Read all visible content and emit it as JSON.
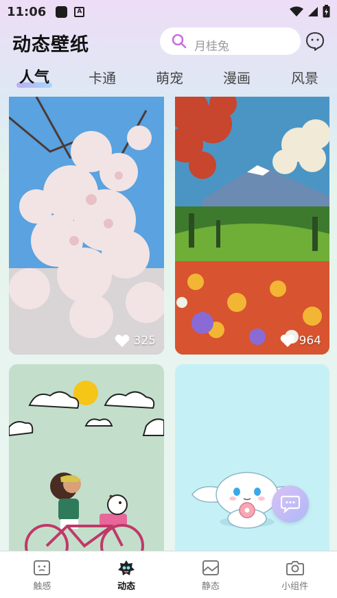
{
  "status_bar": {
    "time": "11:06"
  },
  "header": {
    "title": "动态壁纸",
    "search_placeholder": "月桂兔"
  },
  "tabs": [
    {
      "label": "人气",
      "active": true
    },
    {
      "label": "卡通",
      "active": false
    },
    {
      "label": "萌宠",
      "active": false
    },
    {
      "label": "漫画",
      "active": false
    },
    {
      "label": "风景",
      "active": false
    }
  ],
  "wallpapers": [
    {
      "subject": "cherry blossoms against blue sky",
      "likes": "325"
    },
    {
      "subject": "mountain landscape with flower field",
      "likes": "964"
    },
    {
      "subject": "cartoon girl riding bike with dog",
      "likes": ""
    },
    {
      "subject": "white cartoon puppy eating donut",
      "likes": ""
    }
  ],
  "bottom_nav": [
    {
      "label": "触感",
      "icon": "face-frame-icon",
      "active": false
    },
    {
      "label": "动态",
      "icon": "star-face-icon",
      "active": true
    },
    {
      "label": "静态",
      "icon": "image-icon",
      "active": false
    },
    {
      "label": "小组件",
      "icon": "widget-camera-icon",
      "active": false
    }
  ],
  "colors": {
    "accent": "#b8a7f3",
    "search_icon": "#c86de0"
  }
}
